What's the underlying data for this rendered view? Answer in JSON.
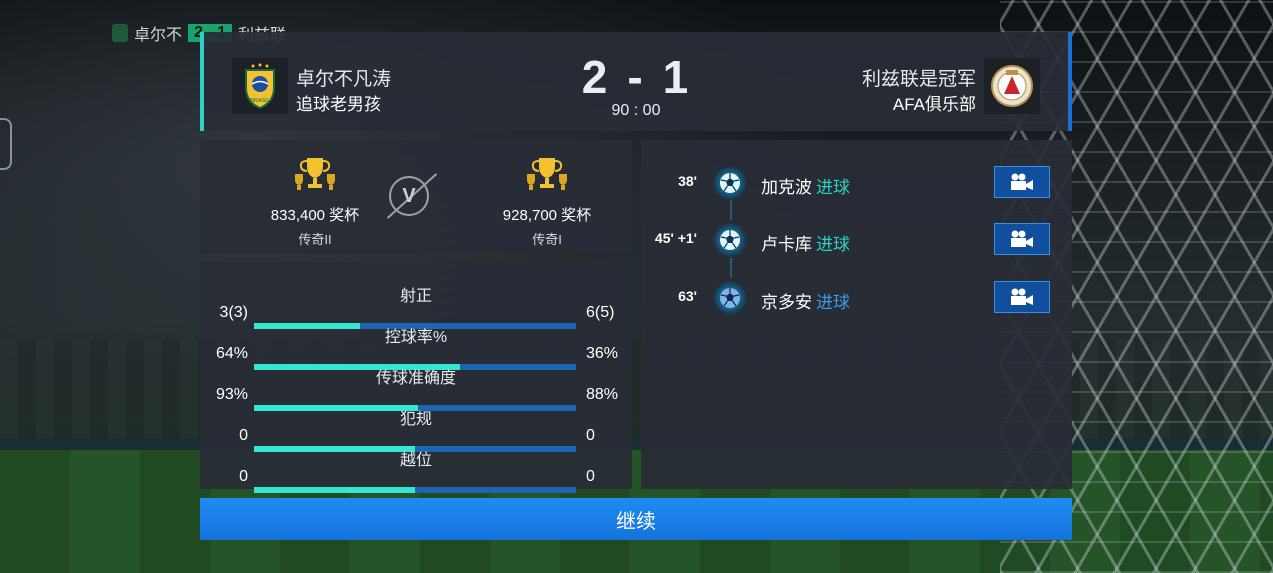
{
  "topbar": {
    "home_short": "卓尔不",
    "score_home": "2",
    "score_away": "1",
    "away_short": "利兹联"
  },
  "header": {
    "home": {
      "name": "卓尔不凡涛",
      "club": "追球老男孩",
      "logo_text": "BRASIL"
    },
    "away": {
      "name": "利兹联是冠军",
      "club": "AFA俱乐部"
    },
    "score_home": "2",
    "score_sep": "-",
    "score_away": "1",
    "time": "90 : 00"
  },
  "trophies": {
    "home": {
      "points": "833,400 奖杯",
      "rank": "传奇II"
    },
    "vs": "V",
    "away": {
      "points": "928,700 奖杯",
      "rank": "传奇I"
    }
  },
  "stats": [
    {
      "label": "射正",
      "home": "3(3)",
      "away": "6(5)",
      "home_share": 0.33
    },
    {
      "label": "控球率%",
      "home": "64%",
      "away": "36%",
      "home_share": 0.64
    },
    {
      "label": "传球准确度",
      "home": "93%",
      "away": "88%",
      "home_share": 0.51
    },
    {
      "label": "犯规",
      "home": "0",
      "away": "0",
      "home_share": 0.5
    },
    {
      "label": "越位",
      "home": "0",
      "away": "0",
      "home_share": 0.5
    }
  ],
  "events": [
    {
      "minute": "38'",
      "player": "加克波",
      "type": "进球"
    },
    {
      "minute": "45' +1'",
      "player": "卢卡库",
      "type": "进球"
    },
    {
      "minute": "63'",
      "player": "京多安",
      "type": "进球"
    }
  ],
  "continue_label": "继续",
  "colors": {
    "accent_teal": "#35e6d0",
    "bar_blue": "#1d64b4",
    "button_blue": "#1f8cf2",
    "trophy_gold": "#f2c230"
  }
}
